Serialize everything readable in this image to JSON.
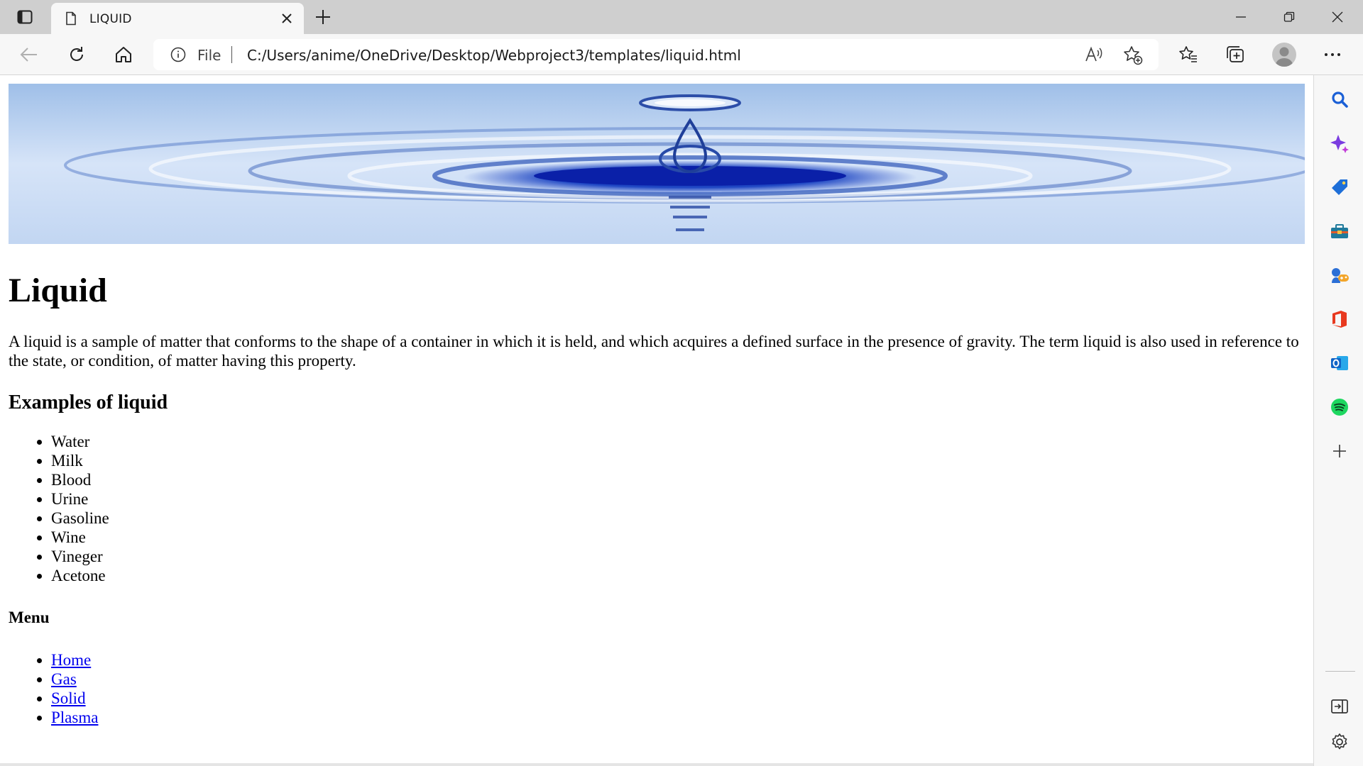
{
  "browser": {
    "tab_title": "LIQUID",
    "address_scheme": "File",
    "address_url": "C:/Users/anime/OneDrive/Desktop/Webproject3/templates/liquid.html"
  },
  "page": {
    "heading": "Liquid",
    "description": "A liquid is a sample of matter that conforms to the shape of a container in which it is held, and which acquires a defined surface in the presence of gravity. The term liquid is also used in reference to the state, or condition, of matter having this property.",
    "examples_heading": "Examples of liquid",
    "examples": [
      "Water",
      "Milk",
      "Blood",
      "Urine",
      "Gasoline",
      "Wine",
      "Vineger",
      "Acetone"
    ],
    "menu_heading": "Menu",
    "menu": [
      "Home",
      "Gas",
      "Solid",
      "Plasma"
    ]
  },
  "sidebar_icons": [
    "search-icon",
    "copilot-icon",
    "shopping-icon",
    "tools-icon",
    "games-icon",
    "office-icon",
    "outlook-icon",
    "spotify-icon",
    "add-icon",
    "hide-sidebar-icon",
    "settings-icon"
  ],
  "colors": {
    "link": "#0000ee",
    "tabstrip": "#cfcfcf",
    "toolbar": "#f7f7f7",
    "water_dark": "#0a2fb0",
    "water_light": "#cfe0f7"
  }
}
